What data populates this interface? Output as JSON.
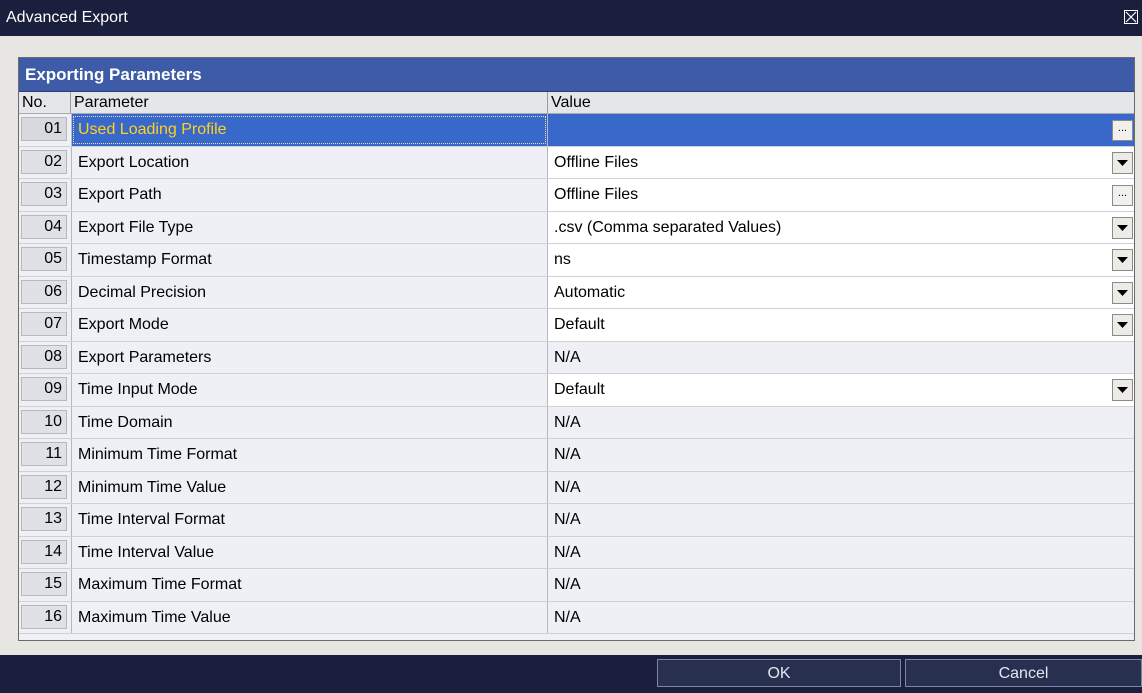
{
  "window": {
    "title": "Advanced Export"
  },
  "grid": {
    "title": "Exporting Parameters",
    "columns": {
      "no": "No.",
      "parameter": "Parameter",
      "value": "Value"
    },
    "rows": [
      {
        "no": "01",
        "parameter": "Used Loading Profile",
        "value": "",
        "control": "ellipsis",
        "selected": true
      },
      {
        "no": "02",
        "parameter": "Export Location",
        "value": "Offline Files",
        "control": "dropdown"
      },
      {
        "no": "03",
        "parameter": "Export Path",
        "value": "Offline Files",
        "control": "ellipsis"
      },
      {
        "no": "04",
        "parameter": "Export File Type",
        "value": ".csv (Comma separated Values)",
        "control": "dropdown"
      },
      {
        "no": "05",
        "parameter": "Timestamp Format",
        "value": "ns",
        "control": "dropdown"
      },
      {
        "no": "06",
        "parameter": "Decimal Precision",
        "value": "Automatic",
        "control": "dropdown"
      },
      {
        "no": "07",
        "parameter": "Export Mode",
        "value": "Default",
        "control": "dropdown"
      },
      {
        "no": "08",
        "parameter": "Export Parameters",
        "value": "N/A",
        "control": "none"
      },
      {
        "no": "09",
        "parameter": "Time Input Mode",
        "value": "Default",
        "control": "dropdown"
      },
      {
        "no": "10",
        "parameter": "Time Domain",
        "value": "N/A",
        "control": "none"
      },
      {
        "no": "11",
        "parameter": "Minimum Time Format",
        "value": "N/A",
        "control": "none"
      },
      {
        "no": "12",
        "parameter": "Minimum Time Value",
        "value": "N/A",
        "control": "none"
      },
      {
        "no": "13",
        "parameter": "Time Interval Format",
        "value": "N/A",
        "control": "none"
      },
      {
        "no": "14",
        "parameter": "Time Interval Value",
        "value": "N/A",
        "control": "none"
      },
      {
        "no": "15",
        "parameter": "Maximum Time Format",
        "value": "N/A",
        "control": "none"
      },
      {
        "no": "16",
        "parameter": "Maximum Time Value",
        "value": "N/A",
        "control": "none"
      }
    ]
  },
  "buttons": {
    "ok": "OK",
    "cancel": "Cancel"
  },
  "ellipsis_label": "...",
  "colors": {
    "header": "#3e5ba8",
    "selected_row": "#3868c9",
    "selected_text": "#ffd21e",
    "chrome": "#1a1f3d"
  },
  "icons": {
    "close": "close-icon",
    "dropdown": "chevron-down-icon"
  }
}
